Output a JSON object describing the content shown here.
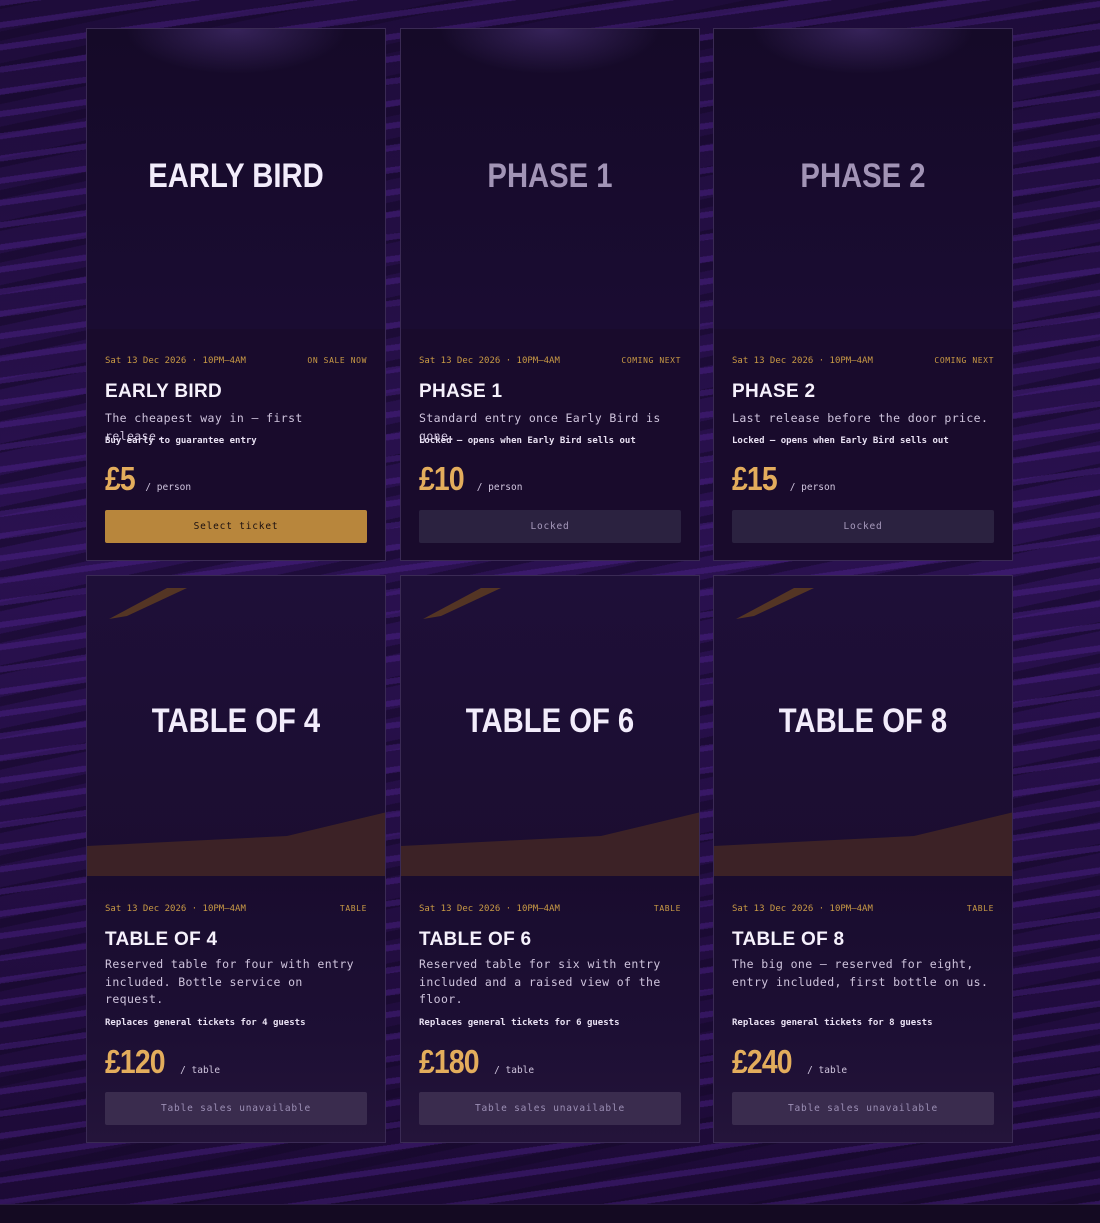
{
  "cards": [
    {
      "hero_title": "EARLY BIRD",
      "date": "Sat 13 Dec 2026 · 10PM–4AM",
      "status": "ON SALE NOW",
      "name": "EARLY BIRD",
      "description": "The cheapest way in — first release.",
      "note": "Buy early to guarantee entry",
      "price": "£5",
      "unit": "/ person",
      "button": "Select ticket"
    },
    {
      "hero_title": "PHASE 1",
      "date": "Sat 13 Dec 2026 · 10PM–4AM",
      "status": "COMING NEXT",
      "name": "PHASE 1",
      "description": "Standard entry once Early Bird is gone.",
      "note": "Locked — opens when Early Bird sells out",
      "price": "£10",
      "unit": "/ person",
      "button": "Locked"
    },
    {
      "hero_title": "PHASE 2",
      "date": "Sat 13 Dec 2026 · 10PM–4AM",
      "status": "COMING NEXT",
      "name": "PHASE 2",
      "description": "Last release before the door price.",
      "note": "Locked — opens when Early Bird sells out",
      "price": "£15",
      "unit": "/ person",
      "button": "Locked"
    },
    {
      "hero_title": "TABLE OF 4",
      "date": "Sat 13 Dec 2026 · 10PM–4AM",
      "status": "TABLE",
      "name": "TABLE OF 4",
      "description": "Reserved table for four with entry included. Bottle service on request.",
      "note": "Replaces general tickets for 4 guests",
      "price": "£120",
      "unit": "/ table",
      "button": "Table sales unavailable"
    },
    {
      "hero_title": "TABLE OF 6",
      "date": "Sat 13 Dec 2026 · 10PM–4AM",
      "status": "TABLE",
      "name": "TABLE OF 6",
      "description": "Reserved table for six with entry included and a raised view of the floor.",
      "note": "Replaces general tickets for 6 guests",
      "price": "£180",
      "unit": "/ table",
      "button": "Table sales unavailable"
    },
    {
      "hero_title": "TABLE OF 8",
      "date": "Sat 13 Dec 2026 · 10PM–4AM",
      "status": "TABLE",
      "name": "TABLE OF 8",
      "description": "The big one — reserved for eight, entry included, first bottle on us.",
      "note": "Replaces general tickets for 8 guests",
      "price": "£240",
      "unit": "/ table",
      "button": "Table sales unavailable"
    }
  ]
}
